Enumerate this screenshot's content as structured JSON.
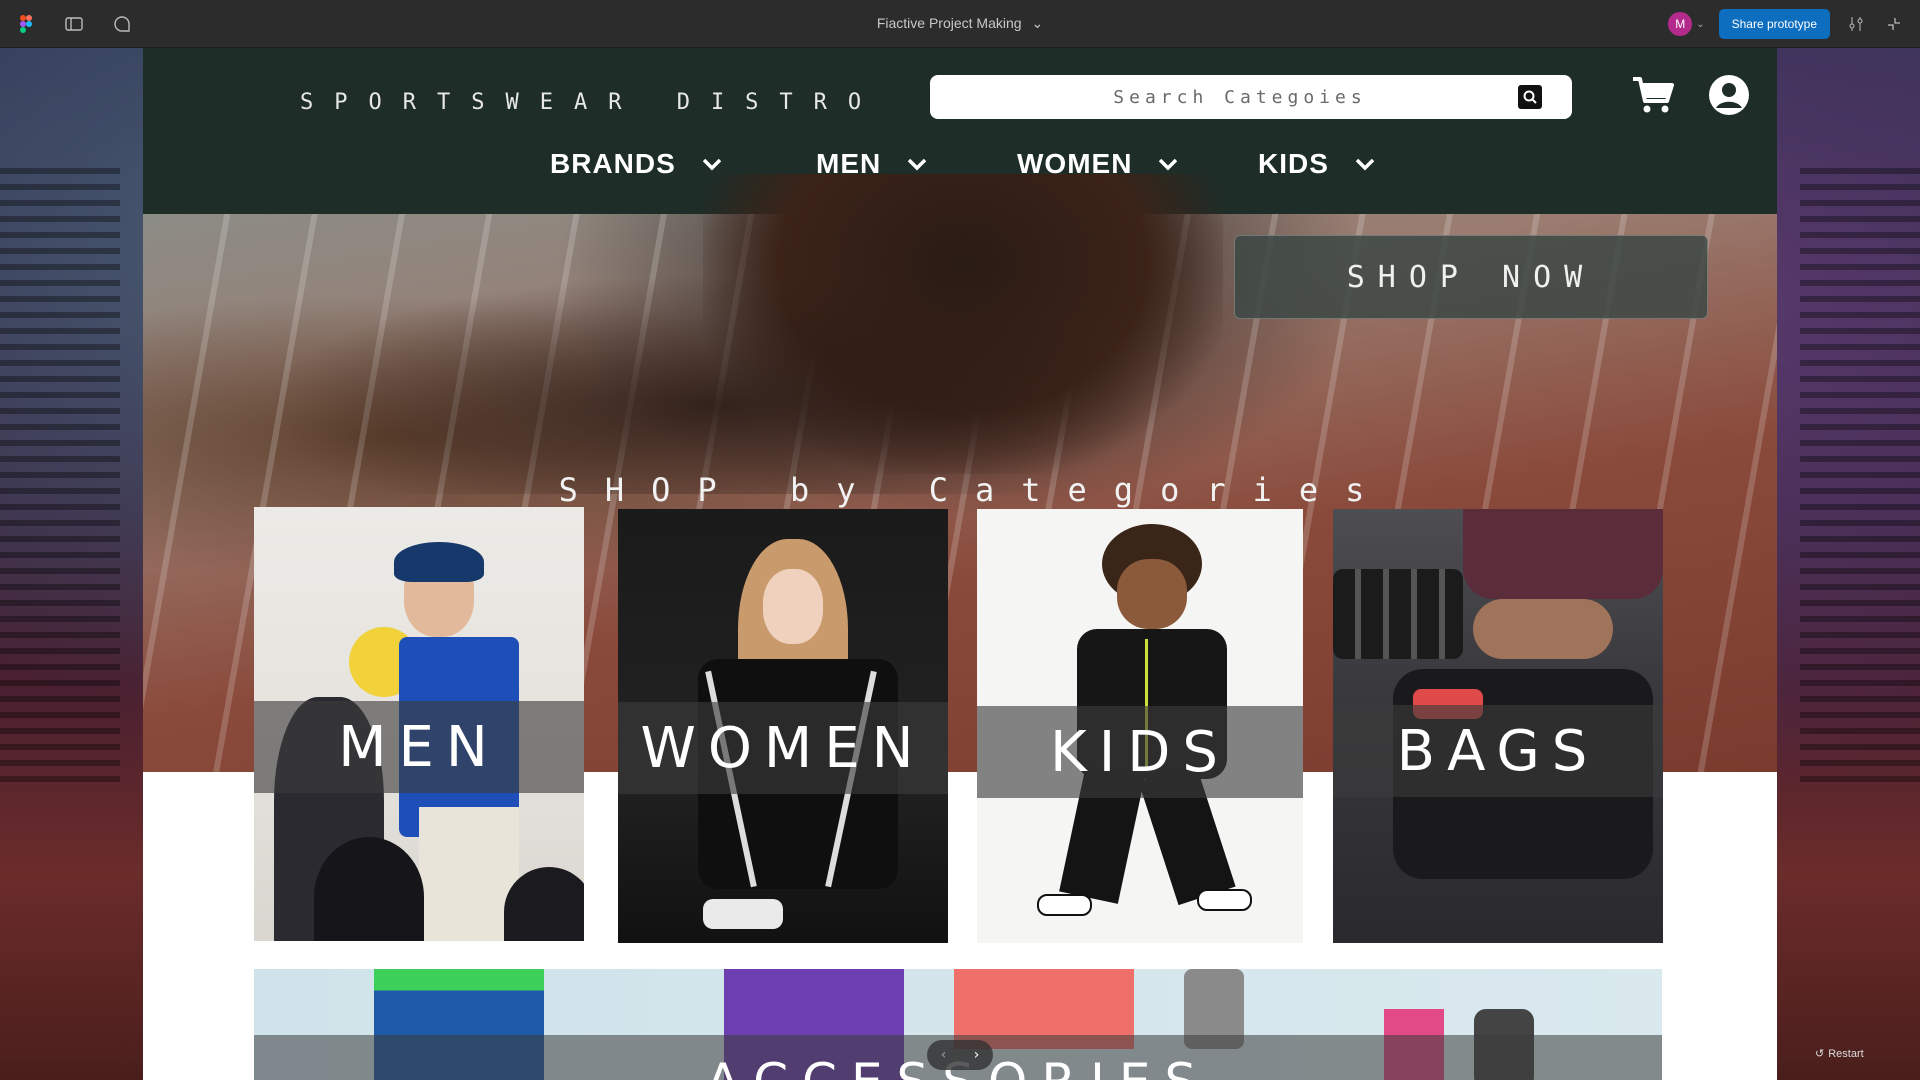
{
  "figma": {
    "file_title": "Fiactive Project Making",
    "avatar_initial": "M",
    "share_label": "Share prototype",
    "restart_label": "Restart"
  },
  "site": {
    "brand": "SPORTSWEAR DISTRO",
    "search": {
      "placeholder": "Search Categoies"
    },
    "menu": [
      {
        "label": "BRANDS"
      },
      {
        "label": "MEN"
      },
      {
        "label": "WOMEN"
      },
      {
        "label": "KIDS"
      }
    ],
    "icons": [
      "cart-icon",
      "account-icon",
      "support-headset-icon"
    ],
    "hero": {
      "cta": "SHOP NOW",
      "section_title": "SHOP by Categories"
    },
    "categories": [
      {
        "label": "MEN"
      },
      {
        "label": "WOMEN"
      },
      {
        "label": "KIDS"
      },
      {
        "label": "BAGS"
      }
    ],
    "accessories_label": "ACCESSORIES"
  },
  "colors": {
    "nav_bg": "#1e2d28",
    "figma_bar": "#2c2c2c",
    "share_btn": "#0d6dbf",
    "avatar": "#b42a8c"
  }
}
